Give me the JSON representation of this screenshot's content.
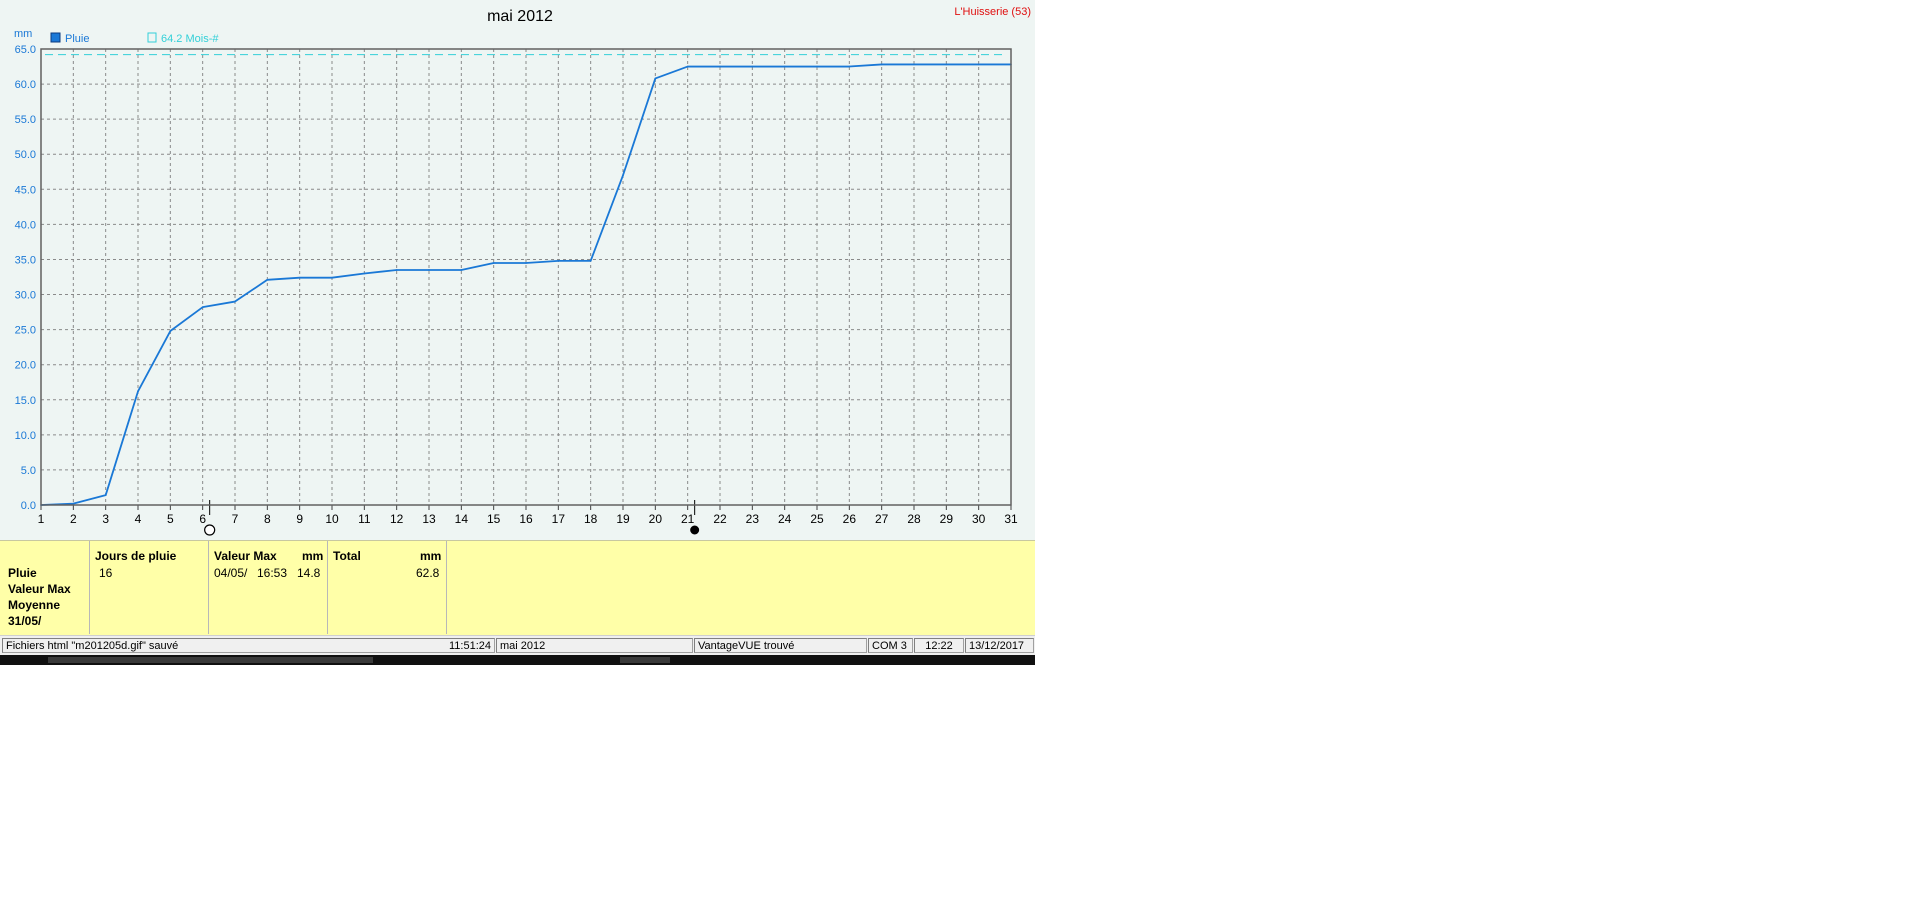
{
  "chart_data": {
    "type": "line",
    "title": "mai 2012",
    "station": "L'Huisserie (53)",
    "ylabel": "mm",
    "ylim": [
      0,
      65
    ],
    "yticks": [
      "0.0",
      "5.0",
      "10.0",
      "15.0",
      "20.0",
      "25.0",
      "30.0",
      "35.0",
      "40.0",
      "45.0",
      "50.0",
      "55.0",
      "60.0",
      "65.0"
    ],
    "x": [
      1,
      2,
      3,
      4,
      5,
      6,
      7,
      8,
      9,
      10,
      11,
      12,
      13,
      14,
      15,
      16,
      17,
      18,
      19,
      20,
      21,
      22,
      23,
      24,
      25,
      26,
      27,
      28,
      29,
      30,
      31
    ],
    "series": [
      {
        "name": "Pluie",
        "color": "#1a78d6",
        "values": [
          0.0,
          0.2,
          1.4,
          16.2,
          24.8,
          28.2,
          29.0,
          32.1,
          32.4,
          32.4,
          33.0,
          33.5,
          33.5,
          33.5,
          34.5,
          34.5,
          34.8,
          34.8,
          47.0,
          60.8,
          62.5,
          62.5,
          62.5,
          62.5,
          62.5,
          62.5,
          62.8,
          62.8,
          62.8,
          62.8,
          62.8
        ]
      }
    ],
    "reference_line": {
      "label": "64.2 Mois-#",
      "value": 64.2,
      "color": "#33d0d8",
      "style": "dashed"
    },
    "grid": true,
    "legend_position": "top-left",
    "moon_markers": [
      {
        "day": 6,
        "phase": "full-moon"
      },
      {
        "day": 21,
        "phase": "new-moon"
      }
    ]
  },
  "summary": {
    "row_labels": [
      "Pluie",
      "Valeur Max",
      "Moyenne",
      "31/05/"
    ],
    "jours_de_pluie": {
      "header": "Jours de pluie",
      "value": "16"
    },
    "valeur_max": {
      "header": "Valeur Max",
      "unit": "mm",
      "date": "04/05/",
      "time": "16:53",
      "value": "14.8"
    },
    "total": {
      "header": "Total",
      "unit": "mm",
      "value": "62.8"
    }
  },
  "status_bar": {
    "message": "Fichiers html  \"m201205d.gif\"  sauvé",
    "time": "11:51:24",
    "period": "mai 2012",
    "station_status": "VantageVUE trouvé",
    "port": "COM 3",
    "clock": "12:22",
    "date": "13/12/2017"
  }
}
